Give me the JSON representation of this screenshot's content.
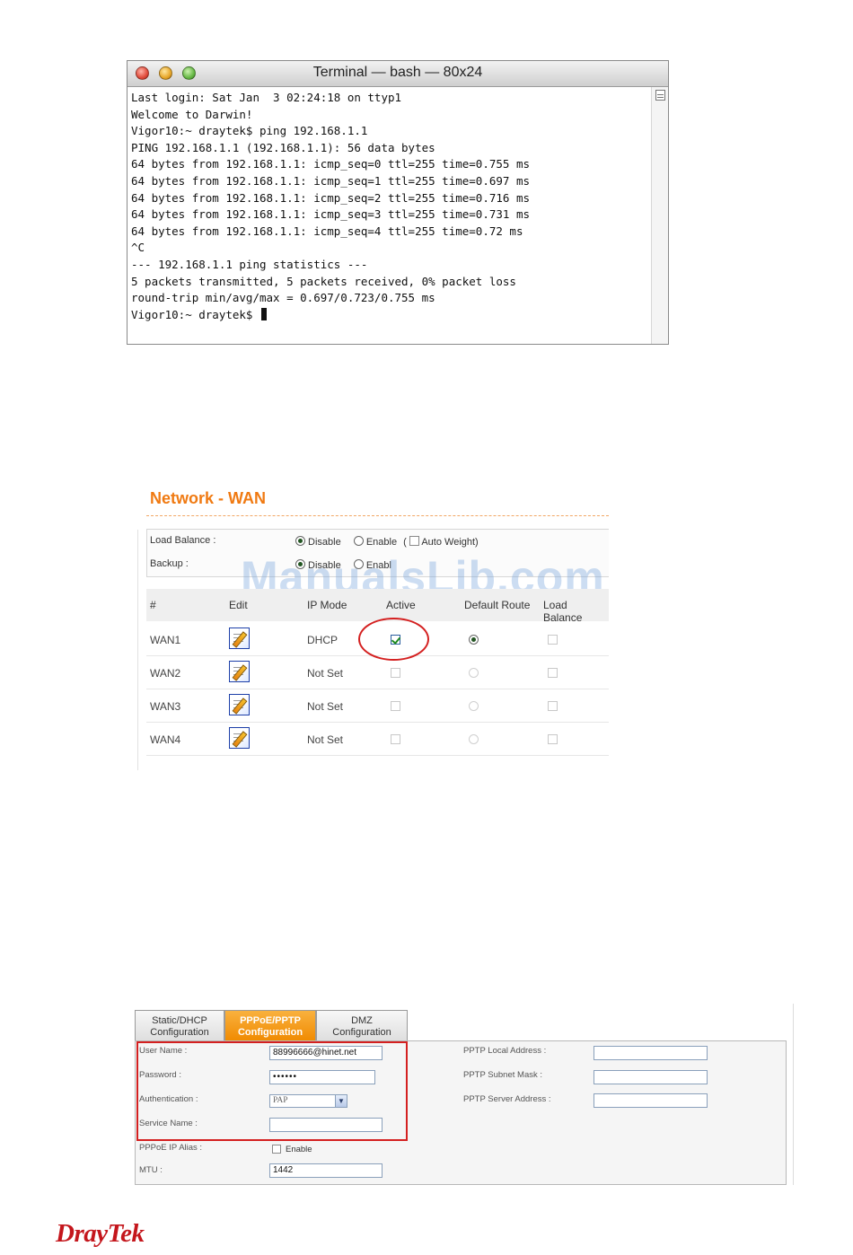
{
  "terminal": {
    "title": "Terminal — bash — 80x24",
    "lines": [
      "Last login: Sat Jan  3 02:24:18 on ttyp1",
      "Welcome to Darwin!",
      "Vigor10:~ draytek$ ping 192.168.1.1",
      "PING 192.168.1.1 (192.168.1.1): 56 data bytes",
      "64 bytes from 192.168.1.1: icmp_seq=0 ttl=255 time=0.755 ms",
      "64 bytes from 192.168.1.1: icmp_seq=1 ttl=255 time=0.697 ms",
      "64 bytes from 192.168.1.1: icmp_seq=2 ttl=255 time=0.716 ms",
      "64 bytes from 192.168.1.1: icmp_seq=3 ttl=255 time=0.731 ms",
      "64 bytes from 192.168.1.1: icmp_seq=4 ttl=255 time=0.72 ms",
      "^C",
      "--- 192.168.1.1 ping statistics ---",
      "5 packets transmitted, 5 packets received, 0% packet loss",
      "round-trip min/avg/max = 0.697/0.723/0.755 ms"
    ],
    "prompt": "Vigor10:~ draytek$ "
  },
  "wan": {
    "title": "Network - WAN",
    "load_balance_label": "Load Balance :",
    "backup_label": "Backup :",
    "disable_label": "Disable",
    "enable_label": "Enable",
    "enable_truncated": "Enabl",
    "open_paren": "(",
    "auto_weight_label": "Auto Weight)",
    "watermark": "ManualsLib.com",
    "headers": {
      "num": "#",
      "edit": "Edit",
      "ip_mode": "IP Mode",
      "active": "Active",
      "default_route": "Default Route",
      "load_balance": "Load Balance"
    },
    "rows": [
      {
        "name": "WAN1",
        "ip_mode": "DHCP"
      },
      {
        "name": "WAN2",
        "ip_mode": "Not Set"
      },
      {
        "name": "WAN3",
        "ip_mode": "Not Set"
      },
      {
        "name": "WAN4",
        "ip_mode": "Not Set"
      }
    ]
  },
  "pppoe": {
    "tabs": [
      {
        "line1": "Static/DHCP",
        "line2": "Configuration"
      },
      {
        "line1": "PPPoE/PPTP",
        "line2": "Configuration"
      },
      {
        "line1": "DMZ",
        "line2": "Configuration"
      }
    ],
    "user_name_label": "User Name :",
    "user_name_value": "88996666@hinet.net",
    "password_label": "Password :",
    "password_value": "••••••",
    "authentication_label": "Authentication :",
    "authentication_value": "PAP",
    "service_name_label": "Service Name :",
    "service_name_value": "",
    "ip_alias_label": "PPPoE IP Alias :",
    "ip_alias_enable_label": "Enable",
    "mtu_label": "MTU :",
    "mtu_value": "1442",
    "pptp_local_label": "PPTP Local Address :",
    "pptp_subnet_label": "PPTP Subnet Mask :",
    "pptp_server_label": "PPTP Server Address :"
  },
  "logo": "DrayTek",
  "colors": {
    "accent_orange": "#f07a12",
    "highlight_red": "#d42020",
    "brand_red": "#c4161c"
  }
}
